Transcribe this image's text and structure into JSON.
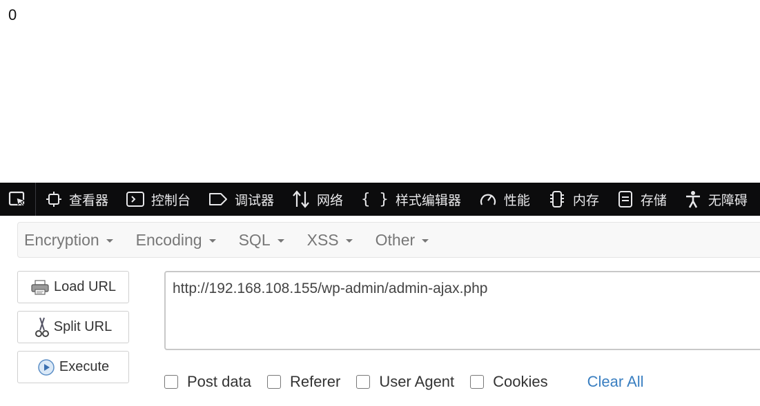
{
  "page": {
    "output_text": "0"
  },
  "devtools": {
    "tabs": [
      {
        "icon": "inspector-icon",
        "label": "查看器"
      },
      {
        "icon": "console-icon",
        "label": "控制台"
      },
      {
        "icon": "debugger-icon",
        "label": "调试器"
      },
      {
        "icon": "network-icon",
        "label": "网络"
      },
      {
        "icon": "style-editor-icon",
        "label": "样式编辑器"
      },
      {
        "icon": "performance-icon",
        "label": "性能"
      },
      {
        "icon": "memory-icon",
        "label": "内存"
      },
      {
        "icon": "storage-icon",
        "label": "存储"
      },
      {
        "icon": "accessibility-icon",
        "label": "无障碍"
      }
    ]
  },
  "hackbar": {
    "menu": [
      "Encryption",
      "Encoding",
      "SQL",
      "XSS",
      "Other"
    ],
    "buttons": {
      "load": "Load URL",
      "split": "Split URL",
      "execute": "Execute"
    },
    "url": "http://192.168.108.155/wp-admin/admin-ajax.php",
    "options": [
      "Post data",
      "Referer",
      "User Agent",
      "Cookies"
    ],
    "clear_all": "Clear All",
    "link_color": "#3a7fc1"
  }
}
